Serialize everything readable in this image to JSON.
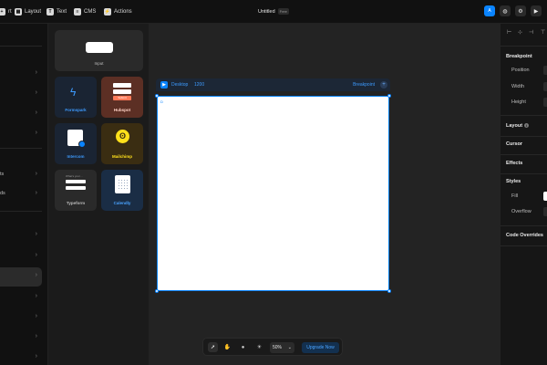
{
  "toolbar": {
    "items": [
      {
        "label": "Layout",
        "icon": "layout-icon"
      },
      {
        "label": "Text",
        "icon": "text-icon"
      },
      {
        "label": "CMS",
        "icon": "cms-icon"
      },
      {
        "label": "Actions",
        "icon": "actions-icon"
      }
    ],
    "insert_partial_label": "rt",
    "project_title": "Untitled",
    "plan_badge": "Free",
    "avatar_initial": "A"
  },
  "left_panel": {
    "items": [
      {
        "label": "ts",
        "chevron": "›"
      },
      {
        "label": "ds",
        "chevron": "›"
      }
    ]
  },
  "insert_panel": {
    "cards": [
      {
        "label": "Input"
      },
      {
        "label": "Formspark"
      },
      {
        "label": "Hubspot",
        "button_text": "Submit"
      },
      {
        "label": "Intercom"
      },
      {
        "label": "Mailchimp"
      },
      {
        "label": "Typeform",
        "preview_text": "What's your…"
      },
      {
        "label": "Calendly"
      }
    ]
  },
  "canvas": {
    "breakpoint": {
      "label": "Desktop",
      "width": "1200",
      "link": "Breakpoint",
      "add": "+"
    },
    "frame_label": "D"
  },
  "bottom_toolbar": {
    "zoom": "50%",
    "upgrade_label": "Upgrade Now"
  },
  "right_panel": {
    "sections": [
      {
        "label": "Breakpoint"
      },
      {
        "label": "Layout"
      },
      {
        "label": "Cursor"
      },
      {
        "label": "Effects"
      },
      {
        "label": "Styles"
      },
      {
        "label": "Code Overrides"
      }
    ],
    "breakpoint_props": [
      "Position",
      "Width",
      "Height"
    ],
    "style_props": [
      "Fill",
      "Overflow"
    ]
  },
  "colors": {
    "accent": "#0a84ff",
    "formspark": "#3d9bff",
    "hubspot": "#ff7a59",
    "mailchimp": "#ffe01b",
    "calendly": "#4aa3ff"
  }
}
